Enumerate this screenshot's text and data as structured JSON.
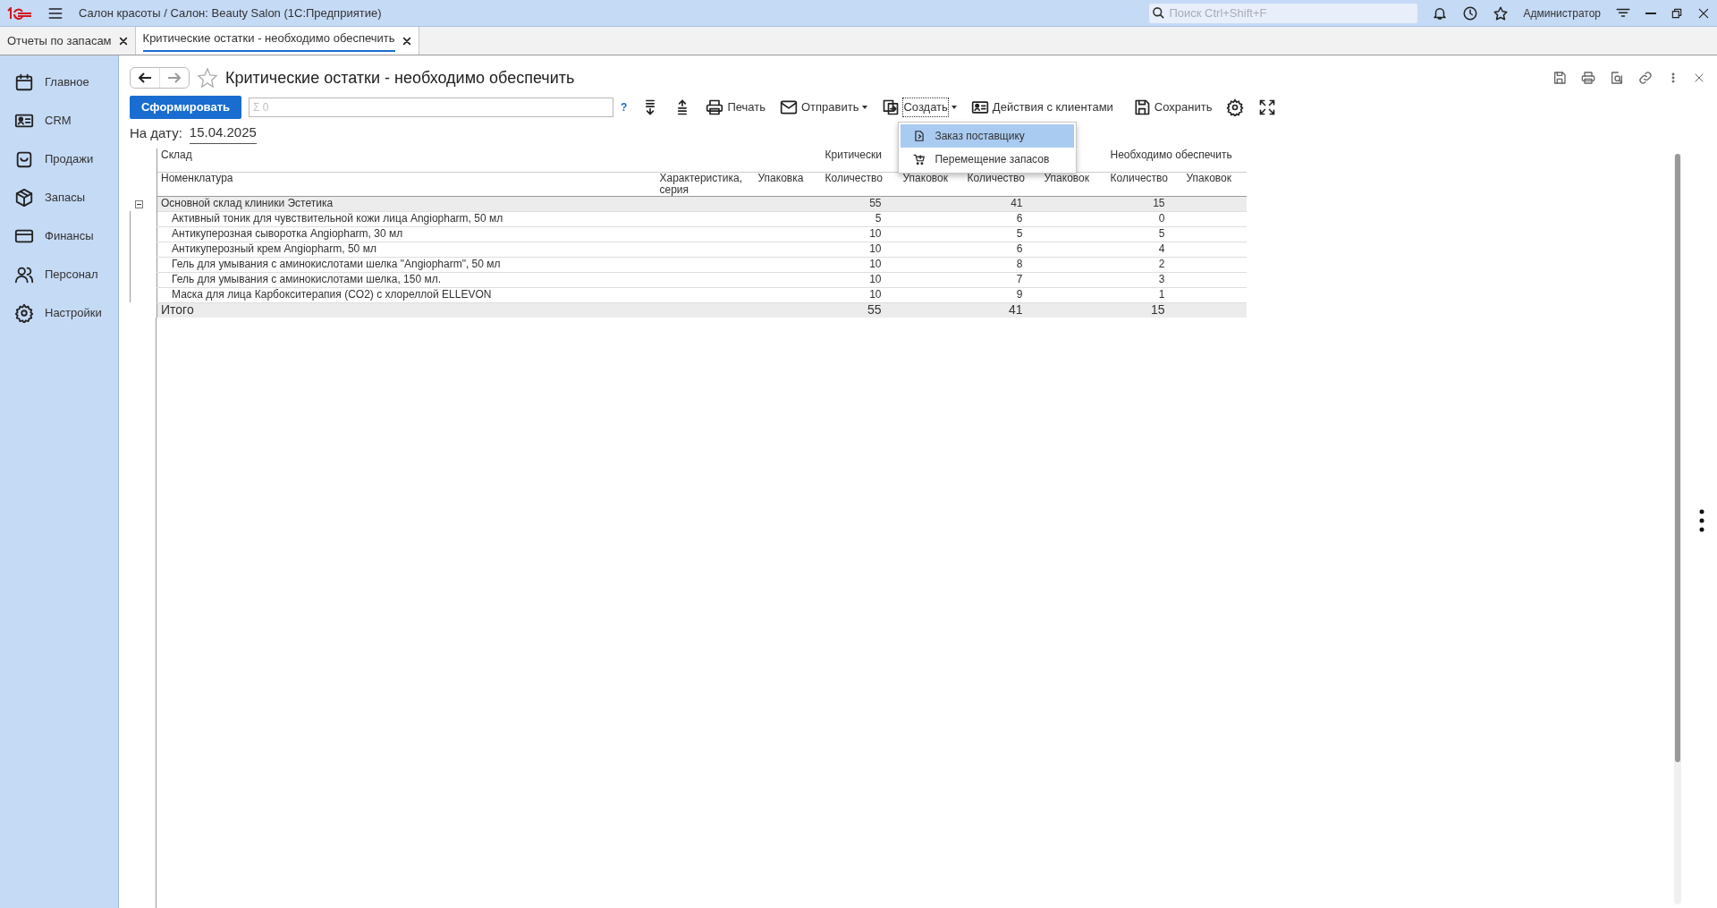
{
  "app": {
    "title": "Салон красоты / Салон: Beauty Salon  (1С:Предприятие)",
    "search": {
      "placeholder": "Поиск Ctrl+Shift+F"
    },
    "user": "Администратор"
  },
  "tabs": [
    {
      "label": "Отчеты по запасам",
      "selected": false
    },
    {
      "label": "Критические остатки - необходимо обеспечить",
      "selected": true
    }
  ],
  "sidebar": {
    "items": [
      {
        "label": "Главное",
        "kind": "calendar"
      },
      {
        "label": "CRM",
        "kind": "card"
      },
      {
        "label": "Продажи",
        "kind": "bag"
      },
      {
        "label": "Запасы",
        "kind": "box"
      },
      {
        "label": "Финансы",
        "kind": "wallet"
      },
      {
        "label": "Персонал",
        "kind": "people"
      },
      {
        "label": "Настройки",
        "kind": "gear"
      }
    ]
  },
  "report": {
    "title": "Критические остатки - необходимо обеспечить",
    "favorite": false,
    "generate_button": "Сформировать",
    "sum_field": {
      "placeholder": "Σ 0"
    },
    "help": "?",
    "toolbar": [
      {
        "kind": "expand",
        "dropdown": false
      },
      {
        "kind": "collapse",
        "dropdown": false
      },
      {
        "kind": "print",
        "label": "Печать",
        "dropdown": false
      },
      {
        "kind": "send",
        "label": "Отправить",
        "dropdown": true
      },
      {
        "kind": "create",
        "label": "Создать",
        "dropdown": true,
        "open": true,
        "menu": [
          {
            "label": "Заказ поставщику",
            "kind": "doc",
            "selected": true
          },
          {
            "label": "Перемещение запасов",
            "kind": "cart",
            "selected": false
          }
        ]
      },
      {
        "kind": "clients",
        "label": "Действия с клиентами",
        "dropdown": false
      },
      {
        "kind": "save",
        "label": "Сохранить",
        "dropdown": false
      },
      {
        "kind": "settings",
        "dropdown": false
      },
      {
        "kind": "fullscreen",
        "dropdown": false
      }
    ],
    "date_label": "На дату:",
    "date": "15.04.2025"
  },
  "table": {
    "group_headers": [
      "Склад",
      "Критически",
      "Необходимо обеспечить"
    ],
    "columns": [
      "Номенклатура",
      "Характеристика, серия",
      "Упаковка",
      "Количество",
      "Упаковок",
      "Количество",
      "Упаковок",
      "Количество",
      "Упаковок"
    ],
    "groups": [
      {
        "name": "Основной склад клиники Эстетика",
        "expanded": true,
        "values": [
          "55",
          "41",
          "15"
        ],
        "rows": [
          {
            "name": "Активный тоник для чувствительной кожи лица Angiopharm, 50 мл",
            "values": [
              "5",
              "6",
              "0"
            ]
          },
          {
            "name": "Антикуперозная сыворотка Angiopharm, 30 мл",
            "values": [
              "10",
              "5",
              "5"
            ]
          },
          {
            "name": "Антикуперозный крем Angiopharm, 50 мл",
            "values": [
              "10",
              "6",
              "4"
            ]
          },
          {
            "name": "Гель для умывания с аминокислотами шелка \"Angiopharm\", 50 мл",
            "values": [
              "10",
              "8",
              "2"
            ]
          },
          {
            "name": "Гель для умывания с аминокислотами шелка, 150 мл.",
            "values": [
              "10",
              "7",
              "3"
            ]
          },
          {
            "name": "Маска для лица Карбокситерапия (CO2) с хлореллой ELLEVON",
            "values": [
              "10",
              "9",
              "1"
            ]
          }
        ]
      }
    ],
    "total": {
      "label": "Итого",
      "values": [
        "55",
        "41",
        "15"
      ]
    }
  }
}
